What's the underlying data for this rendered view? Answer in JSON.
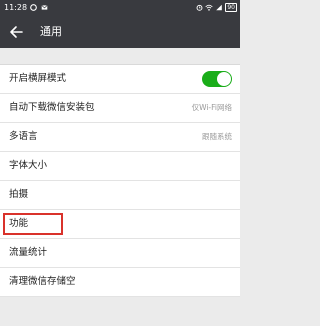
{
  "status_bar": {
    "time": "11:28",
    "battery": "90",
    "icons": [
      "circle-icon",
      "mail-icon",
      "alarm-icon",
      "signal-icon",
      "wifi-icon"
    ]
  },
  "header": {
    "back_icon": "back-arrow-icon",
    "title": "通用"
  },
  "settings": {
    "landscape": {
      "label": "开启横屏模式",
      "enabled": true
    },
    "auto_download": {
      "label": "自动下载微信安装包",
      "value": "仅Wi-Fi网络"
    },
    "language": {
      "label": "多语言",
      "value": "跟随系统"
    },
    "font_size": {
      "label": "字体大小"
    },
    "camera": {
      "label": "拍摄"
    },
    "features": {
      "label": "功能"
    },
    "data_usage": {
      "label": "流量统计"
    },
    "clear_storage": {
      "label": "清理微信存储空"
    }
  },
  "colors": {
    "header_bg": "#393a3f",
    "toggle_on": "#1aad19",
    "highlight": "#d9322b",
    "background": "#ebebeb"
  }
}
